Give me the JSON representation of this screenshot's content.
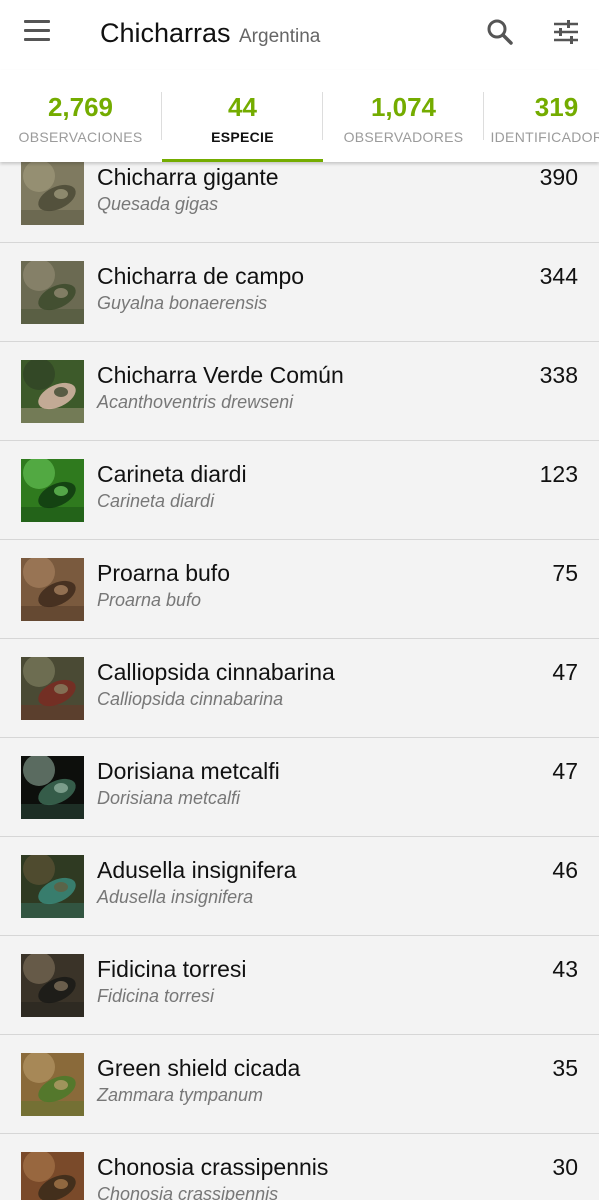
{
  "header": {
    "title": "Chicharras",
    "place": "Argentina",
    "icons": {
      "menu": "menu-icon",
      "search": "search-icon",
      "filter": "filter-sliders-icon"
    }
  },
  "stats": [
    {
      "value": "2,769",
      "label": "OBSERVACIONES",
      "active": false
    },
    {
      "value": "44",
      "label": "ESPECIE",
      "active": true
    },
    {
      "value": "1,074",
      "label": "OBSERVADORES",
      "active": false
    },
    {
      "value": "319",
      "label": "IDENTIFICADORES",
      "active": false
    }
  ],
  "colors": {
    "accent": "#74ac00",
    "background": "#f3f3f3",
    "header": "#ffffff"
  },
  "species": [
    {
      "common": "Chicharra gigante",
      "scientific": "Quesada gigas",
      "count": "390",
      "thumb": [
        "#7f7a60",
        "#4b4a36",
        "#a7a182"
      ]
    },
    {
      "common": "Chicharra de campo",
      "scientific": "Guyalna bonaerensis",
      "count": "344",
      "thumb": [
        "#6b6a52",
        "#3c4a2c",
        "#9b927a"
      ]
    },
    {
      "common": "Chicharra Verde Común",
      "scientific": "Acanthoventris drewseni",
      "count": "338",
      "thumb": [
        "#3d5a2a",
        "#d9b9a8",
        "#2b3a22"
      ]
    },
    {
      "common": "Carineta diardi",
      "scientific": "Carineta diardi",
      "count": "123",
      "thumb": [
        "#2f7a1e",
        "#0f3a10",
        "#6fd060"
      ]
    },
    {
      "common": "Proarna bufo",
      "scientific": "Proarna bufo",
      "count": "75",
      "thumb": [
        "#7a5a3e",
        "#3e2a1c",
        "#b08a66"
      ]
    },
    {
      "common": "Calliopsida cinnabarina",
      "scientific": "Calliopsida cinnabarina",
      "count": "47",
      "thumb": [
        "#4a4a34",
        "#7a2a22",
        "#8a8a6a"
      ]
    },
    {
      "common": "Dorisiana metcalfi",
      "scientific": "Dorisiana metcalfi",
      "count": "47",
      "thumb": [
        "#0d0f0c",
        "#3d6a55",
        "#9ab8a6"
      ]
    },
    {
      "common": "Adusella insignifera",
      "scientific": "Adusella insignifera",
      "count": "46",
      "thumb": [
        "#2f3a22",
        "#3a8a7a",
        "#6a5a3a"
      ]
    },
    {
      "common": "Fidicina torresi",
      "scientific": "Fidicina torresi",
      "count": "43",
      "thumb": [
        "#3a3328",
        "#1a1a16",
        "#8a7a62"
      ]
    },
    {
      "common": "Green shield cicada",
      "scientific": "Zammara tympanum",
      "count": "35",
      "thumb": [
        "#8a6a3a",
        "#4a7a2a",
        "#c0a070"
      ]
    },
    {
      "common": "Chonosia crassipennis",
      "scientific": "Chonosia crassipennis",
      "count": "30",
      "thumb": [
        "#7a4a2a",
        "#3a2a1a",
        "#b08050"
      ]
    }
  ]
}
